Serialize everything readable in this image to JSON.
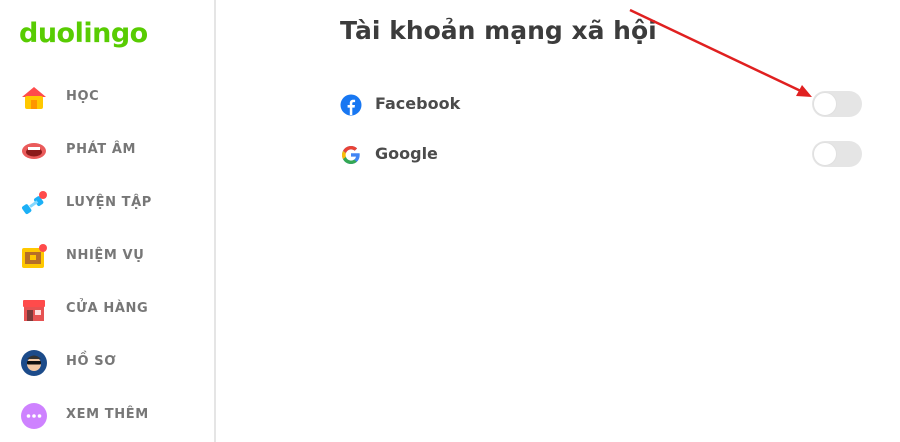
{
  "brand": {
    "logo_text": "duolingo",
    "color": "#58cc02"
  },
  "sidebar": {
    "items": [
      {
        "label": "HỌC",
        "icon": "house-icon"
      },
      {
        "label": "PHÁT ÂM",
        "icon": "mouth-icon"
      },
      {
        "label": "LUYỆN TẬP",
        "icon": "dumbbell-icon"
      },
      {
        "label": "NHIỆM VỤ",
        "icon": "treasure-chest-icon"
      },
      {
        "label": "CỬA HÀNG",
        "icon": "shop-icon"
      },
      {
        "label": "HỒ SƠ",
        "icon": "avatar-icon"
      },
      {
        "label": "XEM THÊM",
        "icon": "more-dots-icon"
      }
    ]
  },
  "main": {
    "title": "Tài khoản mạng xã hội",
    "accounts": [
      {
        "label": "Facebook",
        "icon": "facebook-icon",
        "connected": false
      },
      {
        "label": "Google",
        "icon": "google-icon",
        "connected": false
      }
    ]
  },
  "annotation": {
    "arrow_color": "#e02020"
  }
}
